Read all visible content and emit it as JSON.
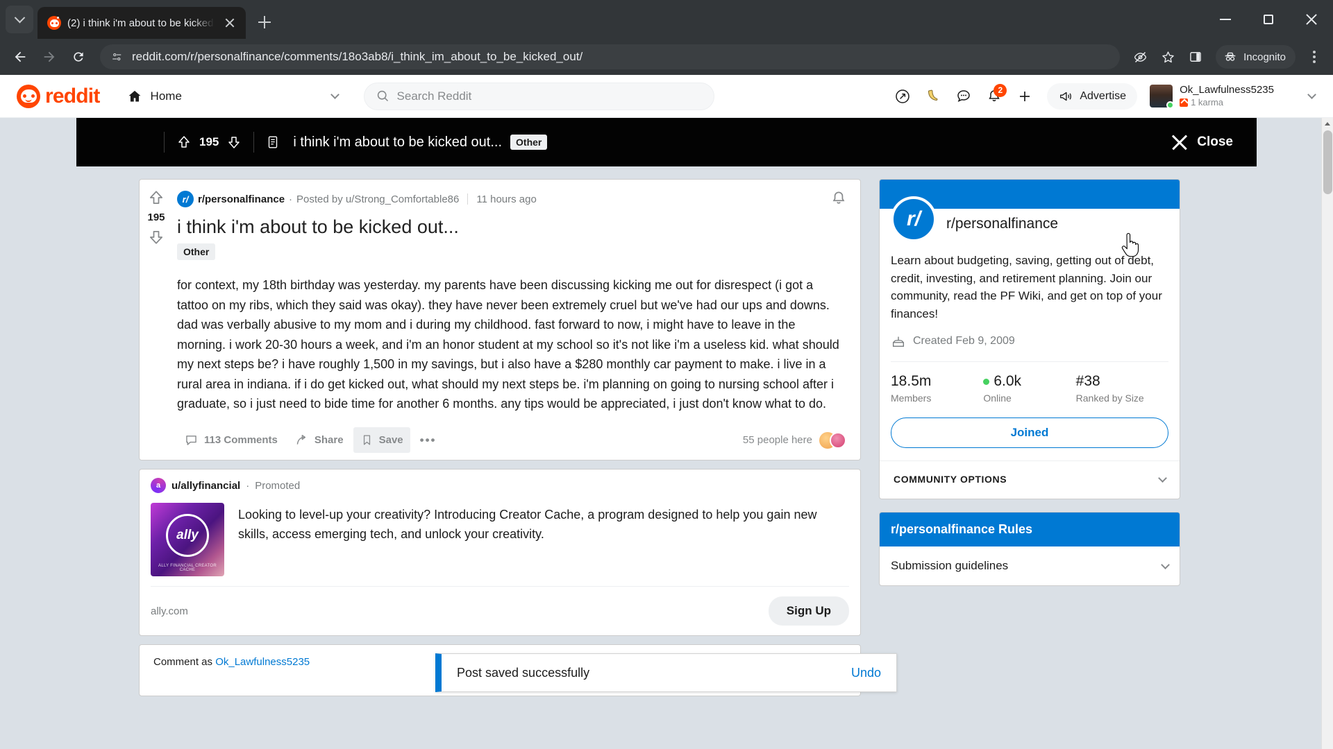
{
  "browser": {
    "tab": {
      "title": "(2) i think i'm about to be kicked ...",
      "favicon": "reddit-icon"
    },
    "new_tab_label": "+",
    "url": "reddit.com/r/personalfinance/comments/18o3ab8/i_think_im_about_to_be_kicked_out/",
    "profile_label": "Incognito",
    "window_controls": {
      "minimize": "minimize",
      "maximize": "maximize",
      "close": "close"
    }
  },
  "reddit_header": {
    "logo_text": "reddit",
    "home_label": "Home",
    "search_placeholder": "Search Reddit",
    "notifications_count": "2",
    "advertise_label": "Advertise",
    "user": {
      "name": "Ok_Lawfulness5235",
      "karma": "1 karma"
    }
  },
  "overlay_bar": {
    "votes": "195",
    "title": "i think i'm about to be kicked out...",
    "flair": "Other",
    "close_label": "Close"
  },
  "post": {
    "votes": "195",
    "subreddit": "r/personalfinance",
    "subreddit_initial": "r/",
    "posted_by": "Posted by u/Strong_Comfortable86",
    "timestamp": "11 hours ago",
    "title": "i think i'm about to be kicked out...",
    "flair": "Other",
    "body": "for context, my 18th birthday was yesterday. my parents have been discussing kicking me out for disrespect (i got a tattoo on my ribs, which they said was okay). they have never been extremely cruel but we've had our ups and downs. dad was verbally abusive to my mom and i during my childhood. fast forward to now, i might have to leave in the morning. i work 20-30 hours a week, and i'm an honor student at my school so it's not like i'm a useless kid. what should my next steps be? i have roughly 1,500 in my savings, but i also have a $280 monthly car payment to make. i live in a rural area in indiana. if i do get kicked out, what should my next steps be. i'm planning on going to nursing school after i graduate, so i just need to bide time for another 6 months. any tips would be appreciated, i just don't know what to do.",
    "actions": {
      "comments": "113 Comments",
      "share": "Share",
      "save": "Save",
      "more": "•••"
    },
    "people_here": "55 people here"
  },
  "ad": {
    "user": "u/allyfinancial",
    "promoted_label": "Promoted",
    "body": "Looking to level-up your creativity? Introducing Creator Cache, a program designed to help you gain new skills, access emerging tech, and unlock your creativity.",
    "thumb_text": "ally",
    "thumb_footer": "ALLY FINANCIAL CREATOR CACHE",
    "domain": "ally.com",
    "cta": "Sign Up"
  },
  "comment_box": {
    "prefix": "Comment as",
    "username": "Ok_Lawfulness5235"
  },
  "sidebar": {
    "community": {
      "name": "r/personalfinance",
      "avatar_text": "r/",
      "description": "Learn about budgeting, saving, getting out of debt, credit, investing, and retirement planning. Join our community, read the PF Wiki, and get on top of your finances!",
      "created": "Created Feb 9, 2009",
      "stats": [
        {
          "value": "18.5m",
          "label": "Members",
          "online": false
        },
        {
          "value": "6.0k",
          "label": "Online",
          "online": true
        },
        {
          "value": "#38",
          "label": "Ranked by Size",
          "online": false
        }
      ],
      "join_button": "Joined",
      "community_options": "COMMUNITY OPTIONS"
    },
    "rules": {
      "header": "r/personalfinance Rules",
      "items": [
        "Submission guidelines"
      ]
    }
  },
  "toast": {
    "message": "Post saved successfully",
    "undo_label": "Undo"
  },
  "colors": {
    "reddit_orange": "#ff4500",
    "reddit_blue": "#0079d3",
    "page_bg": "#dae0e6",
    "overlay_black": "#030303"
  }
}
